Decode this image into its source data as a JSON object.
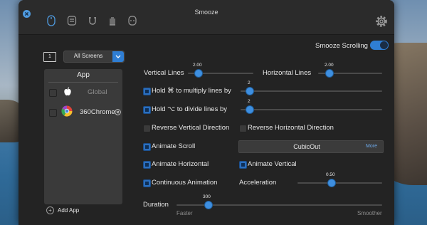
{
  "window": {
    "title": "Smooze"
  },
  "toolbar": {
    "icons": [
      "mouse-icon",
      "keyboard-icon",
      "magnet-icon",
      "hand-icon",
      "gamepad-icon"
    ],
    "settings_icon": "gear-icon"
  },
  "screens": {
    "number": "1",
    "selected": "All Screens"
  },
  "smooze_scrolling": {
    "label": "Smooze Scrolling",
    "on": true
  },
  "app_panel": {
    "header": "App",
    "items": [
      {
        "name": "Global",
        "icon": "apple-icon",
        "checked": false
      },
      {
        "name": "360Chrome",
        "icon": "chrome-icon",
        "checked": false
      }
    ],
    "add_label": "Add App"
  },
  "settings": {
    "vertical_lines": {
      "label": "Vertical Lines",
      "value": "2.00"
    },
    "horizontal_lines": {
      "label": "Horizontal Lines",
      "value": "2.00"
    },
    "hold_multiply": {
      "label": "Hold ⌘ to multiply lines by",
      "value": "2",
      "checked": false
    },
    "hold_divide": {
      "label": "Hold ⌥ to divide lines by",
      "value": "2",
      "checked": false
    },
    "reverse_vertical": {
      "label": "Reverse Vertical Direction",
      "checked": false
    },
    "reverse_horizontal": {
      "label": "Reverse Horizontal Direction",
      "checked": false
    },
    "animate_scroll": {
      "label": "Animate Scroll",
      "checked": false
    },
    "easing": {
      "selected": "CubicOut",
      "more_label": "More"
    },
    "animate_horizontal": {
      "label": "Animate Horizontal",
      "checked": false
    },
    "animate_vertical": {
      "label": "Animate Vertical",
      "checked": false
    },
    "continuous_animation": {
      "label": "Continuous Animation",
      "checked": false
    },
    "acceleration": {
      "label": "Acceleration",
      "value": "0.50"
    },
    "duration": {
      "label": "Duration",
      "value": "300",
      "min_label": "Faster",
      "max_label": "Smoother"
    }
  }
}
